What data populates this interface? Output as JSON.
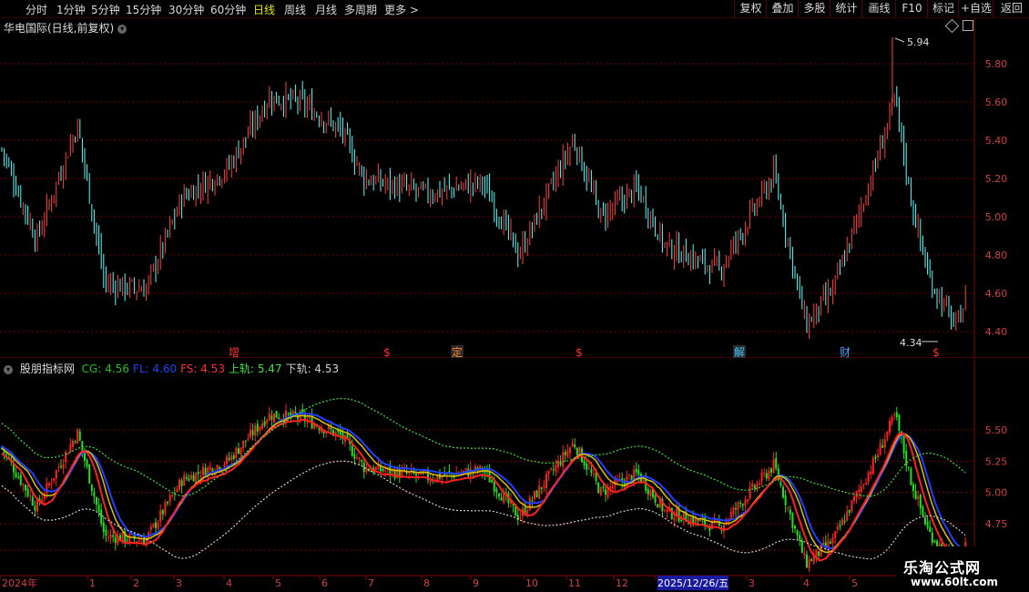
{
  "toolbar": {
    "left_items": [
      "分时",
      "1分钟",
      "5分钟",
      "15分钟",
      "30分钟",
      "60分钟",
      "日线",
      "周线",
      "月线",
      "多周期",
      "更多 >"
    ],
    "active_index": 6,
    "right_items": [
      "复权",
      "叠加",
      "多股",
      "统计",
      "画线",
      "F10",
      "标记",
      "+自选",
      "返回"
    ]
  },
  "main_chart": {
    "title": "华电国际(日线,前复权)",
    "price_labels": [
      "5.80",
      "5.60",
      "5.40",
      "5.20",
      "5.00",
      "4.80",
      "4.60",
      "4.40"
    ],
    "price_values": [
      5.8,
      5.6,
      5.4,
      5.2,
      5.0,
      4.8,
      4.6,
      4.4
    ],
    "high_label": "5.94",
    "low_label": "4.34",
    "event_markers": [
      {
        "text": "增",
        "color": "#ff3030",
        "bg": false
      },
      {
        "text": "$",
        "color": "#ff3030",
        "bg": false
      },
      {
        "text": "定",
        "color": "#ff8020",
        "bg": true
      },
      {
        "text": "$",
        "color": "#ff3030",
        "bg": false
      },
      {
        "text": "解",
        "color": "#40c0ff",
        "bg": true
      },
      {
        "text": "财",
        "color": "#40a0ff",
        "bg": false
      },
      {
        "text": "$",
        "color": "#ff3030",
        "bg": false
      }
    ]
  },
  "indicator": {
    "name": "股朋指标网",
    "items": [
      {
        "label": "CG: 4.56",
        "color": "#20c020"
      },
      {
        "label": "FL: 4.60",
        "color": "#2040ff"
      },
      {
        "label": "FS: 4.53",
        "color": "#ff3030"
      },
      {
        "label": "上轨: 5.47",
        "color": "#40e040"
      },
      {
        "label": "下轨: 4.53",
        "color": "#d0d0d0"
      }
    ],
    "price_labels": [
      "5.50",
      "5.25",
      "5.00",
      "4.75"
    ],
    "price_values": [
      5.5,
      5.25,
      5.0,
      4.75
    ]
  },
  "date_axis": {
    "labels": [
      "2024年",
      "1",
      "2",
      "3",
      "4",
      "5",
      "6",
      "7",
      "8",
      "9",
      "10",
      "11",
      "12",
      "2025/12/26/五",
      "3",
      "4",
      "5"
    ]
  },
  "watermark": {
    "line1": "乐淘公式网",
    "line2": "www.60lt.com"
  },
  "colors": {
    "up": "#ff4040",
    "down": "#54ffff",
    "grid": "#7a0000",
    "axis_text": "#d04040",
    "background": "#000000"
  }
}
